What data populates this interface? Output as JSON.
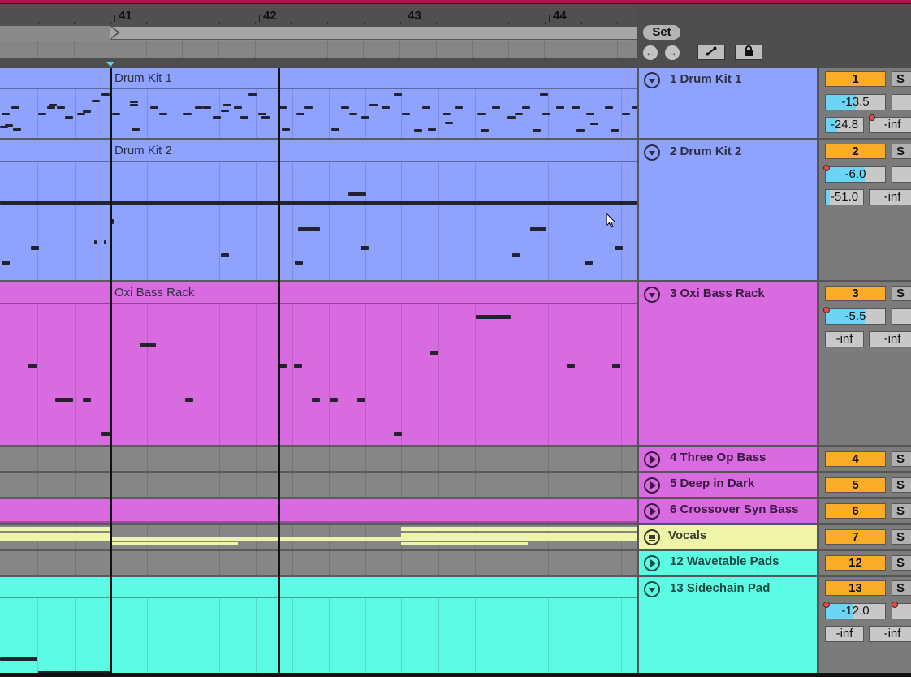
{
  "ruler": {
    "bars": [
      "41",
      "42",
      "43",
      "44"
    ]
  },
  "controls": {
    "set_label": "Set",
    "prev_locator": "previous-locator",
    "next_locator": "next-locator",
    "follow_icon": "curve-icon",
    "lock_icon": "lock-icon"
  },
  "colors": {
    "drum": "#8fa2fd",
    "bass": "#d96be0",
    "vocals": "#eef5a8",
    "pads": "#5cfce4",
    "empty_lane": "#868686",
    "track_number": "#fbad2a",
    "volume_fill": "#6cd4f4",
    "loop_brace": "#a6a6a6",
    "title_bar": "#b0124f"
  },
  "tracks": [
    {
      "id": "1",
      "name": "1 Drum Kit 1",
      "clip": "Drum Kit 1",
      "fold": "down",
      "number": "1",
      "volume": "-13.5",
      "volume_fill": 0.5,
      "pan_or_send": "-24.8",
      "send_fill": 0.3,
      "send2": "-inf",
      "send2_dot": true,
      "vol_dot": false
    },
    {
      "id": "2",
      "name": "2 Drum Kit 2",
      "clip": "Drum Kit 2",
      "fold": "down",
      "number": "2",
      "volume": "-6.0",
      "volume_fill": 0.65,
      "pan_or_send": "-51.0",
      "send_fill": 0.1,
      "send2": "-inf",
      "send2_dot": false,
      "vol_dot": true
    },
    {
      "id": "3",
      "name": "3 Oxi Bass Rack",
      "clip": "Oxi Bass Rack",
      "fold": "down",
      "number": "3",
      "volume": "-5.5",
      "volume_fill": 0.66,
      "pan_or_send": "-inf",
      "send_fill": 0,
      "send2": "-inf",
      "send2_dot": false,
      "vol_dot": true
    },
    {
      "id": "4",
      "name": "4 Three Op Bass",
      "fold": "right",
      "number": "4"
    },
    {
      "id": "5",
      "name": "5 Deep in Dark",
      "fold": "right",
      "number": "5"
    },
    {
      "id": "6",
      "name": "6 Crossover Syn Bass",
      "fold": "right",
      "number": "6"
    },
    {
      "id": "7",
      "name": "Vocals",
      "fold": "menu",
      "number": "7"
    },
    {
      "id": "12",
      "name": "12 Wavetable Pads",
      "fold": "right",
      "number": "12"
    },
    {
      "id": "13",
      "name": "13 Sidechain Pad",
      "fold": "down",
      "number": "13",
      "volume": "-12.0",
      "volume_fill": 0.45,
      "pan_or_send": "-inf",
      "send_fill": 0,
      "send2": "-inf",
      "send2_dot": false,
      "vol_dot": true
    }
  ],
  "solo_label": "S"
}
